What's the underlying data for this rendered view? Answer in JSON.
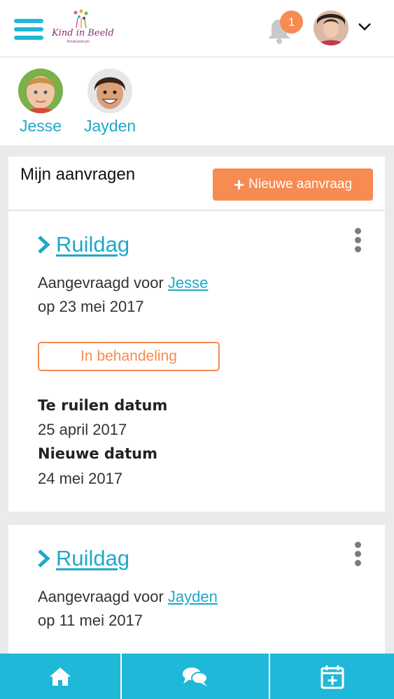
{
  "header": {
    "logo_text": "Kind in Beeld",
    "logo_sub": "Kindcentrum",
    "notification_count": "1"
  },
  "children": [
    {
      "name": "Jesse"
    },
    {
      "name": "Jayden"
    }
  ],
  "panel": {
    "title": "Mijn aanvragen",
    "new_button_label": "Nieuwe aanvraag"
  },
  "requests": [
    {
      "title": "Ruildag",
      "requested_for_label": "Aangevraagd voor",
      "requested_for": "Jesse",
      "date_line": "op 23 mei 2017",
      "status": "In behandeling",
      "swap_date_label": "Te ruilen datum",
      "swap_date": "25 april 2017",
      "new_date_label": "Nieuwe datum",
      "new_date": "24 mei 2017"
    },
    {
      "title": "Ruildag",
      "requested_for_label": "Aangevraagd voor",
      "requested_for": "Jayden",
      "date_line": "op 11 mei 2017"
    }
  ],
  "colors": {
    "accent": "#1fb8d8",
    "link": "#1fa9c9",
    "orange": "#f78b52"
  },
  "icons": {
    "menu": "hamburger-menu-icon",
    "bell": "bell-icon",
    "home": "home-icon",
    "chat": "chat-icon",
    "calendar": "calendar-add-icon"
  }
}
